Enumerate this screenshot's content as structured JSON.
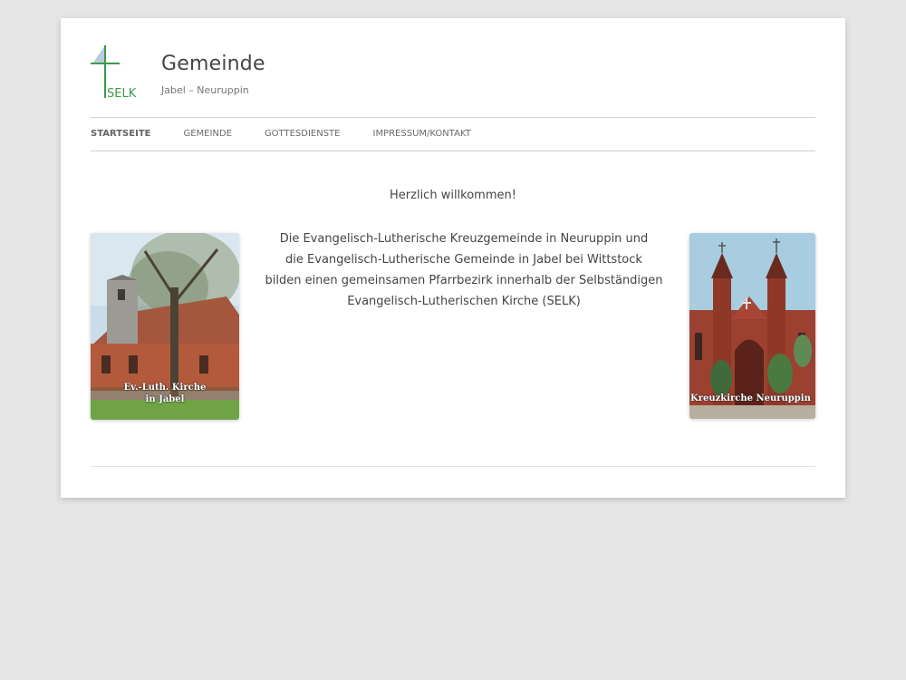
{
  "site": {
    "title": "Gemeinde",
    "description": "Jabel – Neuruppin",
    "logo_text": "SELK"
  },
  "nav": {
    "items": [
      "Startseite",
      "Gemeinde",
      "Gottesdienste",
      "Impressum/Kontakt"
    ],
    "current": "Startseite"
  },
  "main": {
    "welcome": "Herzlich willkommen!",
    "intro_lines": [
      "Die Evangelisch-Lutherische Kreuzgemeinde in Neuruppin und",
      "die Evangelisch-Lutherische Gemeinde in Jabel bei Wittstock",
      "bilden einen gemeinsamen Pfarrbezirk innerhalb der Selbständigen",
      "Evangelisch-Lutherischen Kirche (SELK)"
    ],
    "image_left_caption_1": "Ev.-Luth. Kirche",
    "image_left_caption_2": "in Jabel",
    "image_right_caption": "Kreuzkirche Neuruppin"
  },
  "colors": {
    "background": "#e6e6e6",
    "page": "#ffffff",
    "logo_green": "#3c9a4a",
    "logo_blue": "#2f5f9a"
  }
}
